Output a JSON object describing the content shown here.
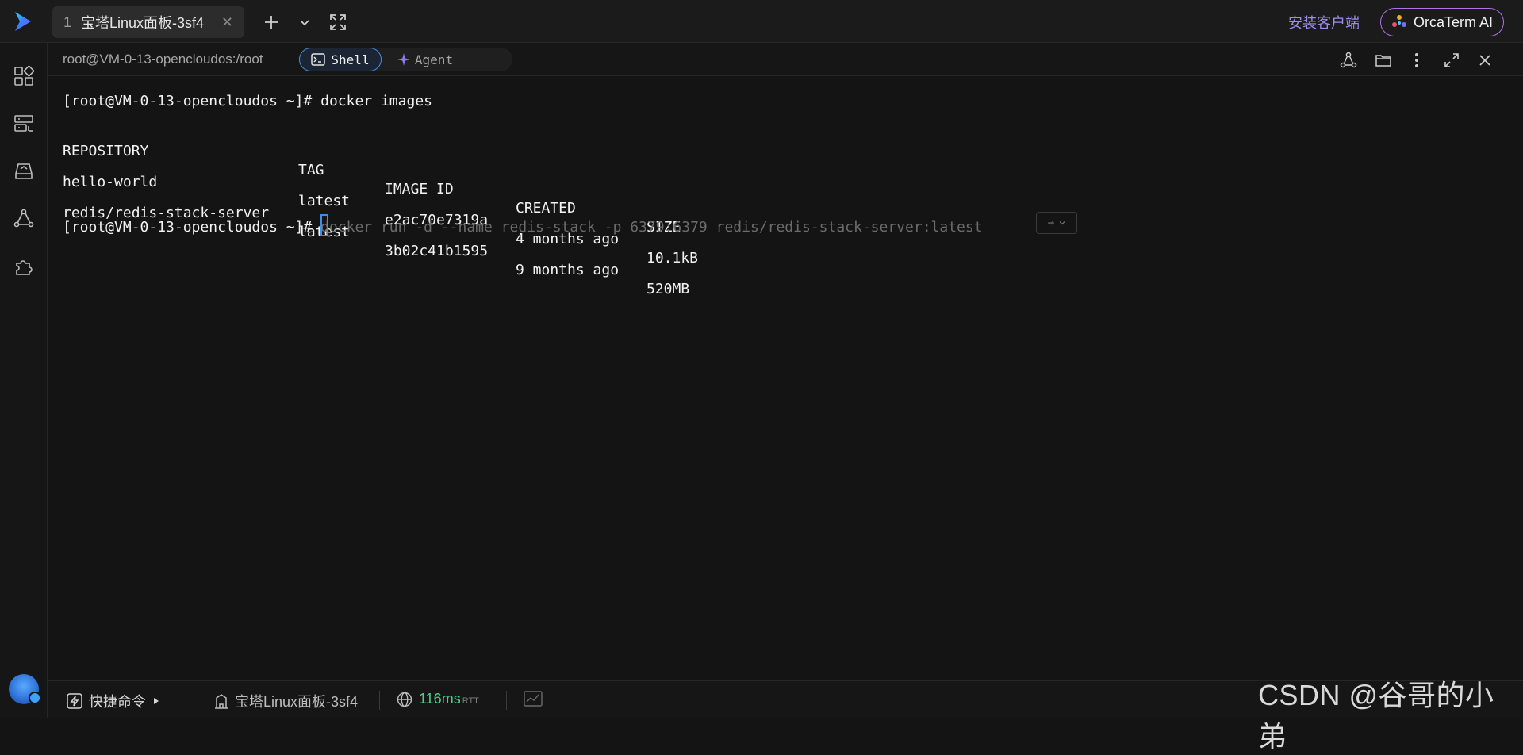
{
  "titlebar": {
    "tab": {
      "number": "1",
      "title": "宝塔Linux面板-3sf4",
      "close": "✕"
    },
    "install_link": "安装客户端",
    "orca_button": "OrcaTerm AI"
  },
  "sidebar": {
    "items": [
      "apps-icon",
      "servers-icon",
      "storage-icon",
      "network-icon",
      "plugins-icon"
    ]
  },
  "session": {
    "path": "root@VM-0-13-opencloudos:/root",
    "modes": {
      "shell": "Shell",
      "agent": "Agent"
    },
    "active_mode": "Shell"
  },
  "terminal": {
    "line1": {
      "prompt": "[root@VM-0-13-opencloudos ~]# ",
      "command": "docker images"
    },
    "table": {
      "headers": [
        "REPOSITORY",
        "TAG",
        "IMAGE ID",
        "CREATED",
        "SIZE"
      ],
      "rows": [
        [
          "hello-world",
          "latest",
          "e2ac70e7319a",
          "4 months ago",
          "10.1kB"
        ],
        [
          "redis/redis-stack-server",
          "latest",
          "3b02c41b1595",
          "9 months ago",
          "520MB"
        ]
      ]
    },
    "line2": {
      "prompt": "[root@VM-0-13-opencloudos ~]# ",
      "suggestion": "docker run -d --name redis-stack -p 6379:6379 redis/redis-stack-server:latest",
      "hint": "→"
    }
  },
  "statusbar": {
    "quick_commands": "快捷命令",
    "server_name": "宝塔Linux面板-3sf4",
    "rtt_value": "116ms",
    "rtt_unit": "RTT"
  },
  "watermark": "CSDN @谷哥的小弟",
  "colors": {
    "accent_blue": "#3d8ee8",
    "accent_purple": "#9d8cf0",
    "rtt_green": "#4ad28b",
    "background": "#141414"
  }
}
